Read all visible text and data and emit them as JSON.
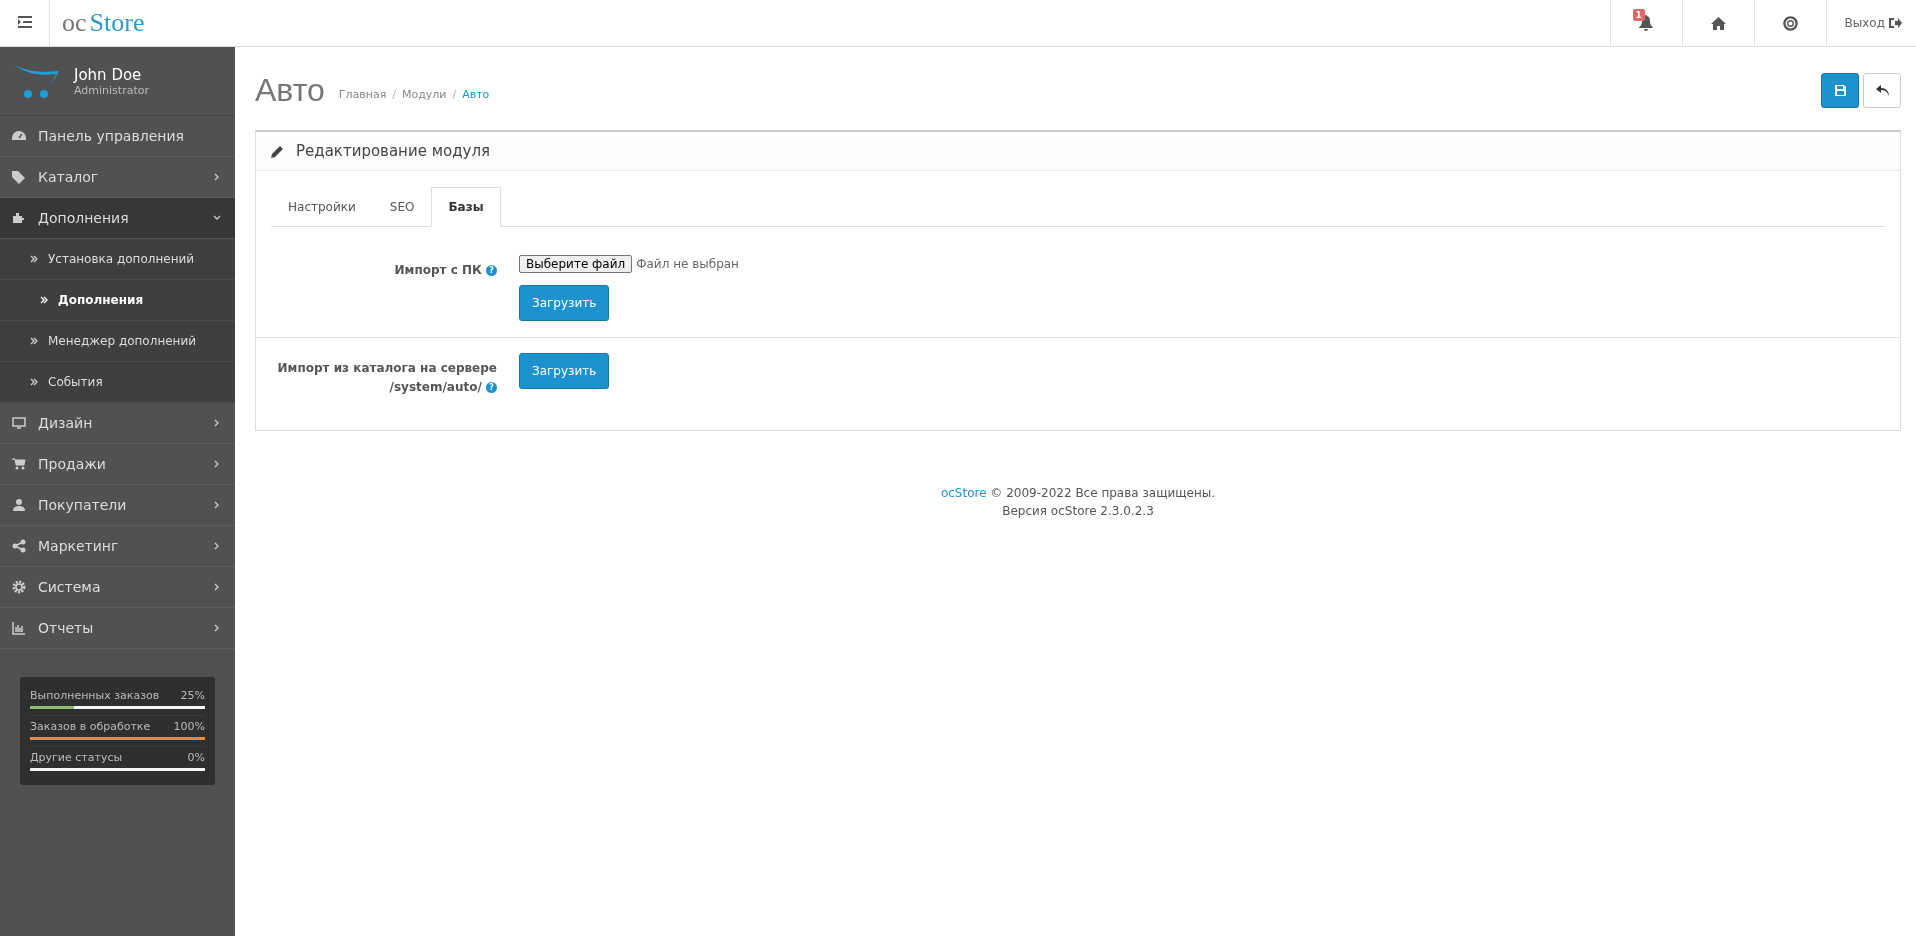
{
  "header": {
    "logo": {
      "prefix": "oc",
      "name": "Store"
    },
    "notification_count": "1",
    "logout": "Выход"
  },
  "user": {
    "name": "John Doe",
    "role": "Administrator"
  },
  "menu": [
    {
      "label": "Панель управления",
      "has_children": false,
      "expanded": false
    },
    {
      "label": "Каталог",
      "has_children": true,
      "expanded": false
    },
    {
      "label": "Дополнения",
      "has_children": true,
      "expanded": true,
      "children": [
        {
          "label": "Установка дополнений",
          "selected": false
        },
        {
          "label": "Дополнения",
          "selected": true
        },
        {
          "label": "Менеджер дополнений",
          "selected": false
        },
        {
          "label": "События",
          "selected": false
        }
      ]
    },
    {
      "label": "Дизайн",
      "has_children": true,
      "expanded": false
    },
    {
      "label": "Продажи",
      "has_children": true,
      "expanded": false
    },
    {
      "label": "Покупатели",
      "has_children": true,
      "expanded": false
    },
    {
      "label": "Маркетинг",
      "has_children": true,
      "expanded": false
    },
    {
      "label": "Система",
      "has_children": true,
      "expanded": false
    },
    {
      "label": "Отчеты",
      "has_children": true,
      "expanded": false
    }
  ],
  "stats": [
    {
      "label": "Выполненных заказов",
      "value": "25%",
      "level": 0.25,
      "color": "#8fbb6c"
    },
    {
      "label": "Заказов в обработке",
      "value": "100%",
      "level": 1,
      "color": "#f38733"
    },
    {
      "label": "Другие статусы",
      "value": "0%",
      "level": 0
    }
  ],
  "page": {
    "title": "Авто",
    "separator": "/",
    "breadcrumbs": [
      {
        "label": "Главная",
        "current": false
      },
      {
        "label": "Модули",
        "current": false
      },
      {
        "label": "Авто",
        "current": true
      }
    ]
  },
  "panel": {
    "title": "Редактирование модуля",
    "tabs": [
      {
        "label": "Настройки",
        "selected": false
      },
      {
        "label": "SEO",
        "selected": false
      },
      {
        "label": "Базы",
        "selected": true
      }
    ],
    "rows": [
      {
        "label": "Импорт с ПК",
        "help": "?",
        "file_button": "Выберите файл",
        "file_status": "Файл не выбран",
        "button": "Загрузить"
      },
      {
        "label": "Импорт из каталога на сервере /system/auto/",
        "help": "?",
        "button": "Загрузить"
      }
    ]
  },
  "footer": {
    "link": "ocStore",
    "text": " © 2009-2022 Все права защищены.",
    "version": "Версия ocStore 2.3.0.2.3"
  }
}
